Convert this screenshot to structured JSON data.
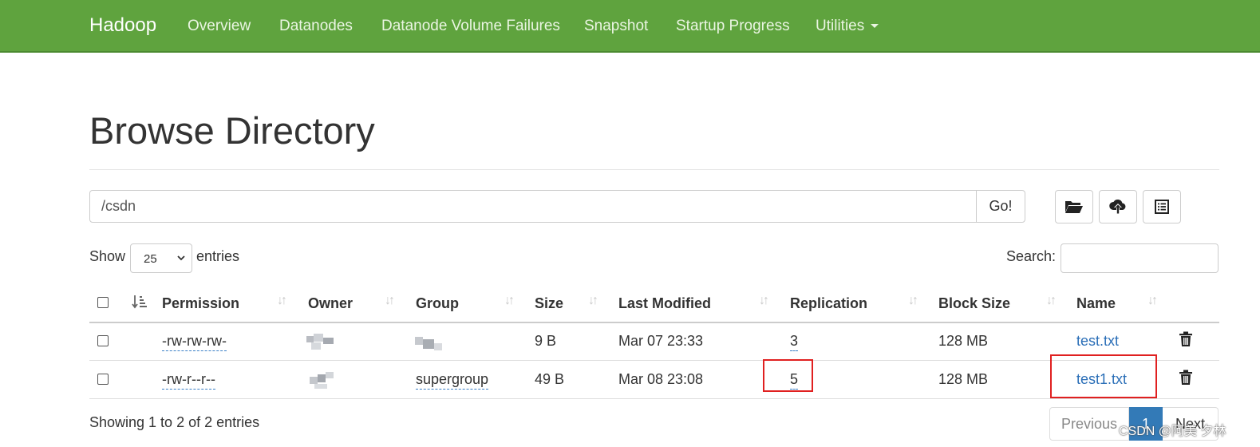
{
  "navbar": {
    "brand": "Hadoop",
    "items": [
      "Overview",
      "Datanodes",
      "Datanode Volume Failures",
      "Snapshot",
      "Startup Progress",
      "Utilities"
    ]
  },
  "page": {
    "title": "Browse Directory"
  },
  "toolbar": {
    "path_value": "/csdn",
    "go_label": "Go!",
    "icons": [
      "folder-open-icon",
      "cloud-upload-icon",
      "list-alt-icon"
    ]
  },
  "table_controls": {
    "show_label": "Show",
    "entries_value": "25",
    "entries_label": "entries",
    "search_label": "Search:"
  },
  "table": {
    "columns": [
      "Permission",
      "Owner",
      "Group",
      "Size",
      "Last Modified",
      "Replication",
      "Block Size",
      "Name"
    ],
    "rows": [
      {
        "permission": "-rw-rw-rw-",
        "owner": "",
        "group": "",
        "size": "9 B",
        "last_modified": "Mar 07 23:33",
        "replication": "3",
        "block_size": "128 MB",
        "name": "test.txt"
      },
      {
        "permission": "-rw-r--r--",
        "owner": "",
        "group": "supergroup",
        "size": "49 B",
        "last_modified": "Mar 08 23:08",
        "replication": "5",
        "block_size": "128 MB",
        "name": "test1.txt"
      }
    ],
    "highlight_color": "#e02020"
  },
  "footer": {
    "showing": "Showing 1 to 2 of 2 entries",
    "prev": "Previous",
    "current": "1",
    "next": "Next"
  },
  "watermark": "CSDN @阿美 夕林",
  "colors": {
    "navbar": "#5fa33e",
    "link": "#2a6eb7",
    "active_page": "#337ab7"
  }
}
